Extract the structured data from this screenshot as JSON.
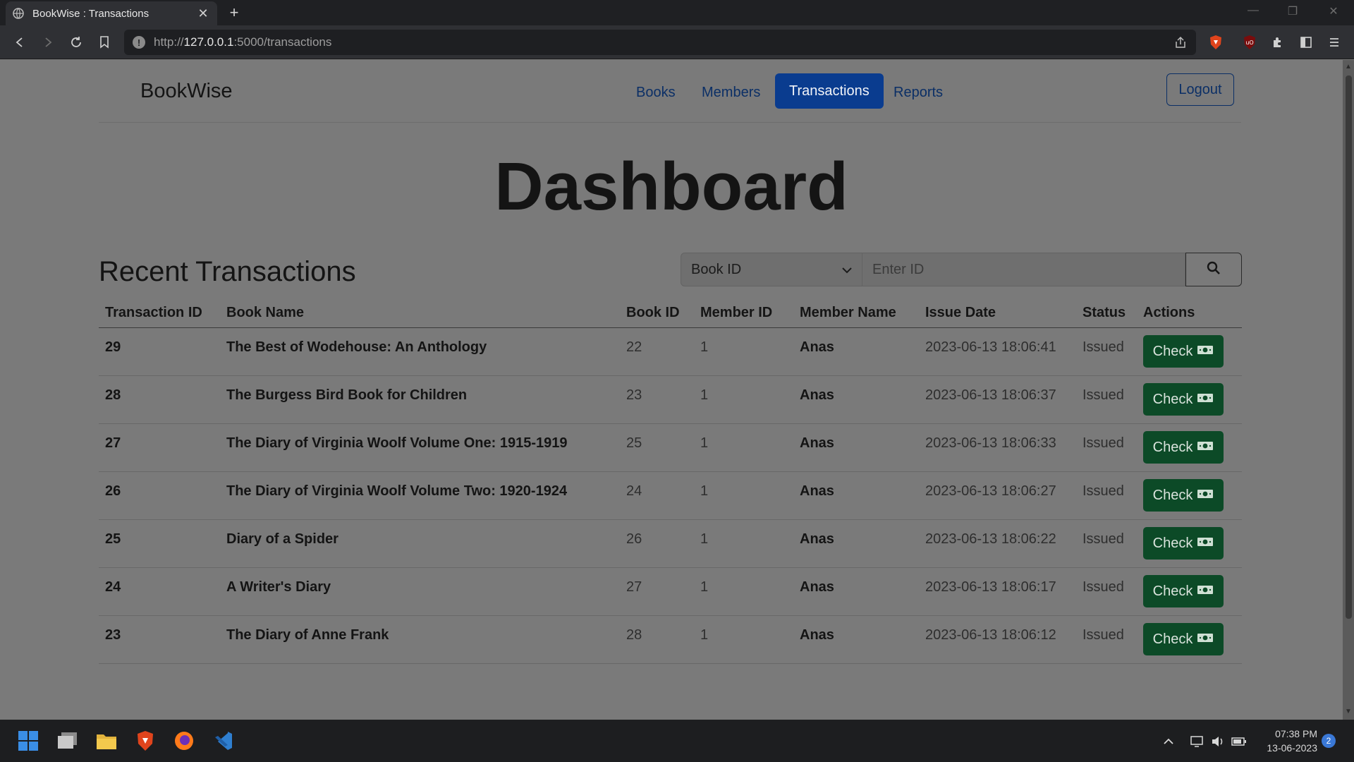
{
  "browser": {
    "tab_title": "BookWise : Transactions",
    "url_scheme": "http://",
    "url_host": "127.0.0.1",
    "url_path": ":5000/transactions"
  },
  "nav": {
    "brand": "BookWise",
    "links": [
      "Books",
      "Members",
      "Transactions",
      "Reports"
    ],
    "active": "Transactions",
    "logout": "Logout"
  },
  "main": {
    "title": "Dashboard",
    "section_title": "Recent Transactions",
    "search": {
      "selected": "Book ID",
      "placeholder": "Enter ID"
    },
    "table": {
      "columns": [
        "Transaction ID",
        "Book Name",
        "Book ID",
        "Member ID",
        "Member Name",
        "Issue Date",
        "Status",
        "Actions"
      ],
      "rows": [
        {
          "id": "29",
          "book": "The Best of Wodehouse: An Anthology",
          "book_id": "22",
          "member_id": "1",
          "member": "Anas",
          "date": "2023-06-13 18:06:41",
          "status": "Issued",
          "action": "Check"
        },
        {
          "id": "28",
          "book": "The Burgess Bird Book for Children",
          "book_id": "23",
          "member_id": "1",
          "member": "Anas",
          "date": "2023-06-13 18:06:37",
          "status": "Issued",
          "action": "Check"
        },
        {
          "id": "27",
          "book": "The Diary of Virginia Woolf Volume One: 1915-1919",
          "book_id": "25",
          "member_id": "1",
          "member": "Anas",
          "date": "2023-06-13 18:06:33",
          "status": "Issued",
          "action": "Check"
        },
        {
          "id": "26",
          "book": "The Diary of Virginia Woolf Volume Two: 1920-1924",
          "book_id": "24",
          "member_id": "1",
          "member": "Anas",
          "date": "2023-06-13 18:06:27",
          "status": "Issued",
          "action": "Check"
        },
        {
          "id": "25",
          "book": "Diary of a Spider",
          "book_id": "26",
          "member_id": "1",
          "member": "Anas",
          "date": "2023-06-13 18:06:22",
          "status": "Issued",
          "action": "Check"
        },
        {
          "id": "24",
          "book": "A Writer's Diary",
          "book_id": "27",
          "member_id": "1",
          "member": "Anas",
          "date": "2023-06-13 18:06:17",
          "status": "Issued",
          "action": "Check"
        },
        {
          "id": "23",
          "book": "The Diary of Anne Frank",
          "book_id": "28",
          "member_id": "1",
          "member": "Anas",
          "date": "2023-06-13 18:06:12",
          "status": "Issued",
          "action": "Check"
        }
      ]
    }
  },
  "taskbar": {
    "time": "07:38 PM",
    "date": "13-06-2023",
    "notifications": "2"
  },
  "colors": {
    "primary": "#0a3c8f",
    "success": "#0c4a27",
    "page_bg": "#7a7a7a"
  }
}
